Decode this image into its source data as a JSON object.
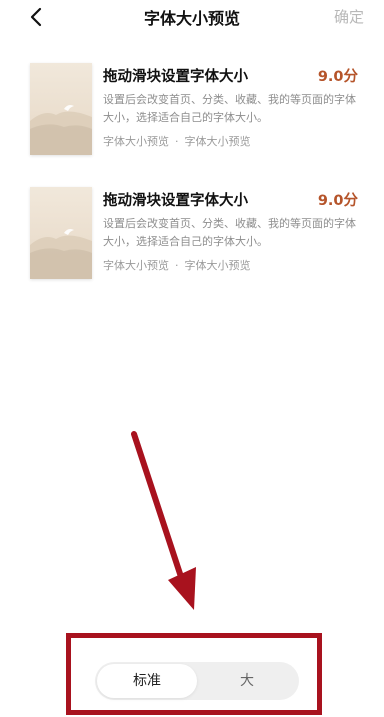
{
  "header": {
    "title": "字体大小预览",
    "confirm_label": "确定",
    "back_icon": "chevron-left-icon"
  },
  "books": [
    {
      "title": "拖动滑块设置字体大小",
      "score": "9.0分",
      "description": "设置后会改变首页、分类、收藏、我的等页面的字体大小，选择适合自己的字体大小。",
      "tag1": "字体大小预览",
      "separator": "·",
      "tag2": "字体大小预览"
    },
    {
      "title": "拖动滑块设置字体大小",
      "score": "9.0分",
      "description": "设置后会改变首页、分类、收藏、我的等页面的字体大小，选择适合自己的字体大小。",
      "tag1": "字体大小预览",
      "separator": "·",
      "tag2": "字体大小预览"
    }
  ],
  "font_size_selector": {
    "options": [
      "标准",
      "大"
    ],
    "selected": "标准"
  },
  "colors": {
    "score": "#b5542a",
    "annotation": "#a8121e"
  }
}
